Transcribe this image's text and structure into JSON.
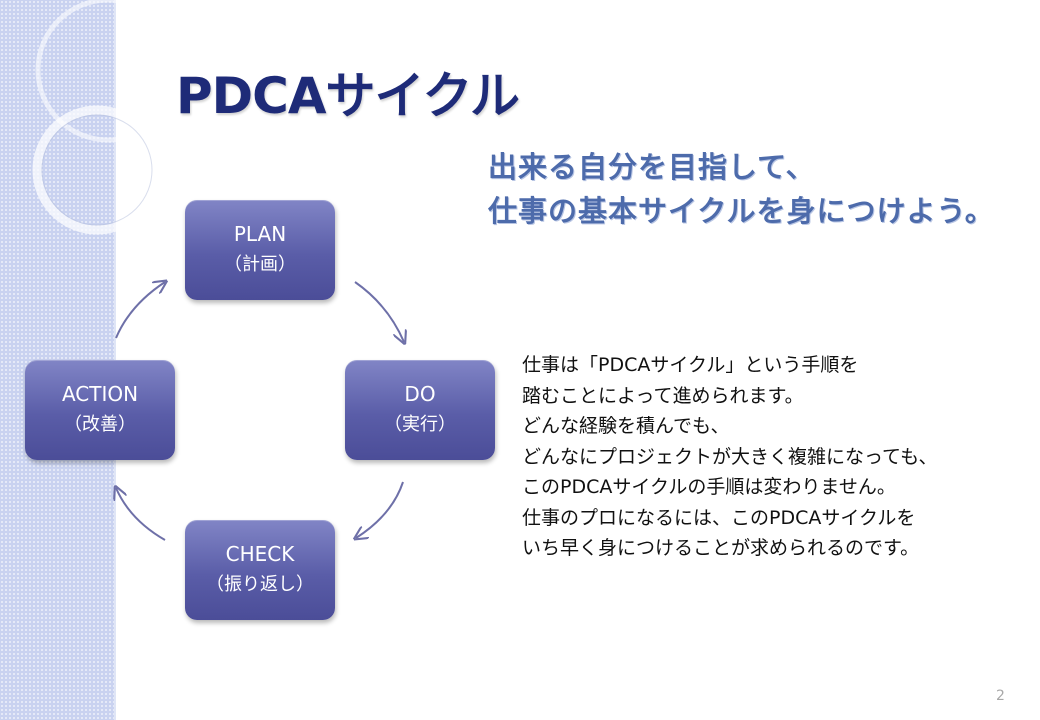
{
  "slide": {
    "title": "PDCAサイクル",
    "subtitle_lines": [
      "出来る自分を目指して、",
      "仕事の基本サイクルを身につけよう。"
    ],
    "page_number": "2"
  },
  "cycle": {
    "plan": {
      "en": "PLAN",
      "jp": "（計画）"
    },
    "do": {
      "en": "DO",
      "jp": "（実行）"
    },
    "check": {
      "en": "CHECK",
      "jp": "（振り返し）"
    },
    "action": {
      "en": "ACTION",
      "jp": "（改善）"
    }
  },
  "body_lines": [
    "仕事は「PDCAサイクル」という手順を",
    "踏むことによって進められます。",
    "どんな経験を積んでも、",
    "どんなにプロジェクトが大きく複雑になっても、",
    "このPDCAサイクルの手順は変わりません。",
    "仕事のプロになるには、このPDCAサイクルを",
    "いち早く身につけることが求められるのです。"
  ],
  "colors": {
    "title": "#1e2b78",
    "subtitle": "#4d6bab",
    "box": "#5a5da8",
    "arrow": "#6e70a8",
    "band": "#c9d2f0"
  }
}
